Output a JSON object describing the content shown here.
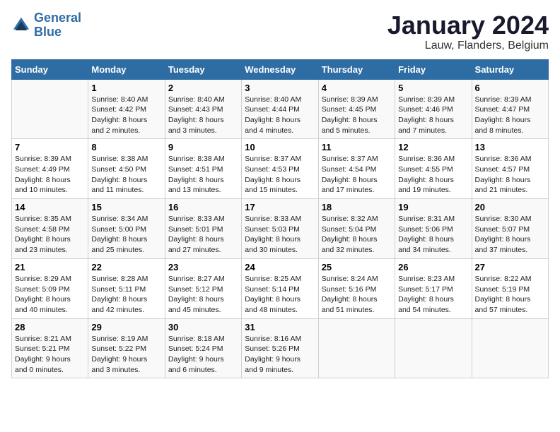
{
  "header": {
    "logo_line1": "General",
    "logo_line2": "Blue",
    "month_title": "January 2024",
    "location": "Lauw, Flanders, Belgium"
  },
  "days_of_week": [
    "Sunday",
    "Monday",
    "Tuesday",
    "Wednesday",
    "Thursday",
    "Friday",
    "Saturday"
  ],
  "weeks": [
    [
      {
        "num": "",
        "info": ""
      },
      {
        "num": "1",
        "info": "Sunrise: 8:40 AM\nSunset: 4:42 PM\nDaylight: 8 hours\nand 2 minutes."
      },
      {
        "num": "2",
        "info": "Sunrise: 8:40 AM\nSunset: 4:43 PM\nDaylight: 8 hours\nand 3 minutes."
      },
      {
        "num": "3",
        "info": "Sunrise: 8:40 AM\nSunset: 4:44 PM\nDaylight: 8 hours\nand 4 minutes."
      },
      {
        "num": "4",
        "info": "Sunrise: 8:39 AM\nSunset: 4:45 PM\nDaylight: 8 hours\nand 5 minutes."
      },
      {
        "num": "5",
        "info": "Sunrise: 8:39 AM\nSunset: 4:46 PM\nDaylight: 8 hours\nand 7 minutes."
      },
      {
        "num": "6",
        "info": "Sunrise: 8:39 AM\nSunset: 4:47 PM\nDaylight: 8 hours\nand 8 minutes."
      }
    ],
    [
      {
        "num": "7",
        "info": "Sunrise: 8:39 AM\nSunset: 4:49 PM\nDaylight: 8 hours\nand 10 minutes."
      },
      {
        "num": "8",
        "info": "Sunrise: 8:38 AM\nSunset: 4:50 PM\nDaylight: 8 hours\nand 11 minutes."
      },
      {
        "num": "9",
        "info": "Sunrise: 8:38 AM\nSunset: 4:51 PM\nDaylight: 8 hours\nand 13 minutes."
      },
      {
        "num": "10",
        "info": "Sunrise: 8:37 AM\nSunset: 4:53 PM\nDaylight: 8 hours\nand 15 minutes."
      },
      {
        "num": "11",
        "info": "Sunrise: 8:37 AM\nSunset: 4:54 PM\nDaylight: 8 hours\nand 17 minutes."
      },
      {
        "num": "12",
        "info": "Sunrise: 8:36 AM\nSunset: 4:55 PM\nDaylight: 8 hours\nand 19 minutes."
      },
      {
        "num": "13",
        "info": "Sunrise: 8:36 AM\nSunset: 4:57 PM\nDaylight: 8 hours\nand 21 minutes."
      }
    ],
    [
      {
        "num": "14",
        "info": "Sunrise: 8:35 AM\nSunset: 4:58 PM\nDaylight: 8 hours\nand 23 minutes."
      },
      {
        "num": "15",
        "info": "Sunrise: 8:34 AM\nSunset: 5:00 PM\nDaylight: 8 hours\nand 25 minutes."
      },
      {
        "num": "16",
        "info": "Sunrise: 8:33 AM\nSunset: 5:01 PM\nDaylight: 8 hours\nand 27 minutes."
      },
      {
        "num": "17",
        "info": "Sunrise: 8:33 AM\nSunset: 5:03 PM\nDaylight: 8 hours\nand 30 minutes."
      },
      {
        "num": "18",
        "info": "Sunrise: 8:32 AM\nSunset: 5:04 PM\nDaylight: 8 hours\nand 32 minutes."
      },
      {
        "num": "19",
        "info": "Sunrise: 8:31 AM\nSunset: 5:06 PM\nDaylight: 8 hours\nand 34 minutes."
      },
      {
        "num": "20",
        "info": "Sunrise: 8:30 AM\nSunset: 5:07 PM\nDaylight: 8 hours\nand 37 minutes."
      }
    ],
    [
      {
        "num": "21",
        "info": "Sunrise: 8:29 AM\nSunset: 5:09 PM\nDaylight: 8 hours\nand 40 minutes."
      },
      {
        "num": "22",
        "info": "Sunrise: 8:28 AM\nSunset: 5:11 PM\nDaylight: 8 hours\nand 42 minutes."
      },
      {
        "num": "23",
        "info": "Sunrise: 8:27 AM\nSunset: 5:12 PM\nDaylight: 8 hours\nand 45 minutes."
      },
      {
        "num": "24",
        "info": "Sunrise: 8:25 AM\nSunset: 5:14 PM\nDaylight: 8 hours\nand 48 minutes."
      },
      {
        "num": "25",
        "info": "Sunrise: 8:24 AM\nSunset: 5:16 PM\nDaylight: 8 hours\nand 51 minutes."
      },
      {
        "num": "26",
        "info": "Sunrise: 8:23 AM\nSunset: 5:17 PM\nDaylight: 8 hours\nand 54 minutes."
      },
      {
        "num": "27",
        "info": "Sunrise: 8:22 AM\nSunset: 5:19 PM\nDaylight: 8 hours\nand 57 minutes."
      }
    ],
    [
      {
        "num": "28",
        "info": "Sunrise: 8:21 AM\nSunset: 5:21 PM\nDaylight: 9 hours\nand 0 minutes."
      },
      {
        "num": "29",
        "info": "Sunrise: 8:19 AM\nSunset: 5:22 PM\nDaylight: 9 hours\nand 3 minutes."
      },
      {
        "num": "30",
        "info": "Sunrise: 8:18 AM\nSunset: 5:24 PM\nDaylight: 9 hours\nand 6 minutes."
      },
      {
        "num": "31",
        "info": "Sunrise: 8:16 AM\nSunset: 5:26 PM\nDaylight: 9 hours\nand 9 minutes."
      },
      {
        "num": "",
        "info": ""
      },
      {
        "num": "",
        "info": ""
      },
      {
        "num": "",
        "info": ""
      }
    ]
  ]
}
